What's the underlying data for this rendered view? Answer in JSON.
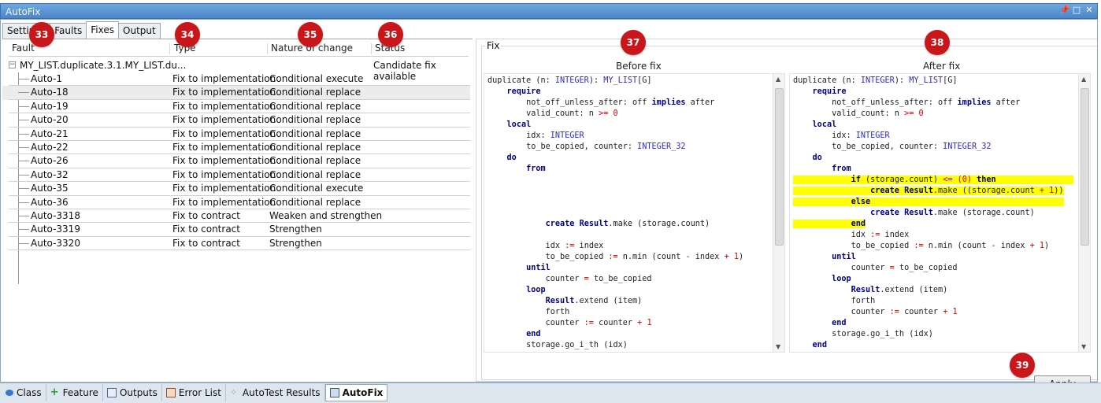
{
  "window": {
    "title": "AutoFix"
  },
  "tabs": [
    {
      "label": "Settings"
    },
    {
      "label": "Faults"
    },
    {
      "label": "Fixes"
    },
    {
      "label": "Output"
    }
  ],
  "table": {
    "headers": {
      "fault": "Fault",
      "type": "Type",
      "nature": "Nature of change",
      "status": "Status"
    },
    "root": {
      "label": "MY_LIST.duplicate.3.1.MY_LIST.du...",
      "status": "Candidate fix available"
    },
    "rows": [
      {
        "fault": "Auto-1",
        "type": "Fix to implementation",
        "nature": "Conditional execute"
      },
      {
        "fault": "Auto-18",
        "type": "Fix to implementation",
        "nature": "Conditional replace"
      },
      {
        "fault": "Auto-19",
        "type": "Fix to implementation",
        "nature": "Conditional replace"
      },
      {
        "fault": "Auto-20",
        "type": "Fix to implementation",
        "nature": "Conditional replace"
      },
      {
        "fault": "Auto-21",
        "type": "Fix to implementation",
        "nature": "Conditional replace"
      },
      {
        "fault": "Auto-22",
        "type": "Fix to implementation",
        "nature": "Conditional replace"
      },
      {
        "fault": "Auto-26",
        "type": "Fix to implementation",
        "nature": "Conditional replace"
      },
      {
        "fault": "Auto-32",
        "type": "Fix to implementation",
        "nature": "Conditional replace"
      },
      {
        "fault": "Auto-35",
        "type": "Fix to implementation",
        "nature": "Conditional execute"
      },
      {
        "fault": "Auto-36",
        "type": "Fix to implementation",
        "nature": "Conditional replace"
      },
      {
        "fault": "Auto-3318",
        "type": "Fix to contract",
        "nature": "Weaken and strengthen"
      },
      {
        "fault": "Auto-3319",
        "type": "Fix to contract",
        "nature": "Strengthen"
      },
      {
        "fault": "Auto-3320",
        "type": "Fix to contract",
        "nature": "Strengthen"
      }
    ]
  },
  "fix": {
    "legend": "Fix",
    "before_label": "Before fix",
    "after_label": "After fix",
    "apply_label": "Apply"
  },
  "badges": {
    "b33": "33",
    "b34": "34",
    "b35": "35",
    "b36": "36",
    "b37": "37",
    "b38": "38",
    "b39": "39"
  },
  "bottom_tabs": [
    {
      "label": "Class"
    },
    {
      "label": "Feature"
    },
    {
      "label": "Outputs"
    },
    {
      "label": "Error List"
    },
    {
      "label": "AutoTest Results"
    },
    {
      "label": "AutoFix"
    }
  ],
  "code": {
    "before": [
      [
        [
          "n",
          "duplicate (n: "
        ],
        [
          "t",
          "INTEGER"
        ],
        [
          "n",
          "): "
        ],
        [
          "t",
          "MY_LIST"
        ],
        [
          "n",
          "[G]"
        ]
      ],
      [
        [
          "n",
          "    "
        ],
        [
          "k",
          "require"
        ]
      ],
      [
        [
          "n",
          "        not_off_unless_after: off "
        ],
        [
          "k",
          "implies"
        ],
        [
          "n",
          " after"
        ]
      ],
      [
        [
          "n",
          "        valid_count: n "
        ],
        [
          "o",
          ">="
        ],
        [
          "n",
          " "
        ],
        [
          "o",
          "0"
        ]
      ],
      [
        [
          "n",
          "    "
        ],
        [
          "k",
          "local"
        ]
      ],
      [
        [
          "n",
          "        idx: "
        ],
        [
          "t",
          "INTEGER"
        ]
      ],
      [
        [
          "n",
          "        to_be_copied, counter: "
        ],
        [
          "t",
          "INTEGER_32"
        ]
      ],
      [
        [
          "n",
          "    "
        ],
        [
          "k",
          "do"
        ]
      ],
      [
        [
          "n",
          "        "
        ],
        [
          "k",
          "from"
        ]
      ],
      [
        [
          "n",
          ""
        ]
      ],
      [
        [
          "n",
          ""
        ]
      ],
      [
        [
          "n",
          ""
        ]
      ],
      [
        [
          "n",
          ""
        ]
      ],
      [
        [
          "n",
          "            "
        ],
        [
          "k",
          "create"
        ],
        [
          "n",
          " "
        ],
        [
          "k",
          "Result"
        ],
        [
          "n",
          ".make (storage.count)"
        ]
      ],
      [
        [
          "n",
          ""
        ]
      ],
      [
        [
          "n",
          "            idx "
        ],
        [
          "o",
          ":="
        ],
        [
          "n",
          " index"
        ]
      ],
      [
        [
          "n",
          "            to_be_copied "
        ],
        [
          "o",
          ":="
        ],
        [
          "n",
          " n.min (count "
        ],
        [
          "o",
          "-"
        ],
        [
          "n",
          " index "
        ],
        [
          "o",
          "+"
        ],
        [
          "n",
          " "
        ],
        [
          "o",
          "1"
        ],
        [
          "n",
          ")"
        ]
      ],
      [
        [
          "n",
          "        "
        ],
        [
          "k",
          "until"
        ]
      ],
      [
        [
          "n",
          "            counter "
        ],
        [
          "o",
          "="
        ],
        [
          "n",
          " to_be_copied"
        ]
      ],
      [
        [
          "n",
          "        "
        ],
        [
          "k",
          "loop"
        ]
      ],
      [
        [
          "n",
          "            "
        ],
        [
          "k",
          "Result"
        ],
        [
          "n",
          ".extend (item)"
        ]
      ],
      [
        [
          "n",
          "            forth"
        ]
      ],
      [
        [
          "n",
          "            counter "
        ],
        [
          "o",
          ":="
        ],
        [
          "n",
          " counter "
        ],
        [
          "o",
          "+"
        ],
        [
          "n",
          " "
        ],
        [
          "o",
          "1"
        ]
      ],
      [
        [
          "n",
          "        "
        ],
        [
          "k",
          "end"
        ]
      ],
      [
        [
          "n",
          "        storage.go_i_th (idx)"
        ]
      ],
      [
        [
          "n",
          "    "
        ],
        [
          "k",
          "end"
        ]
      ]
    ],
    "after": [
      [
        [
          "n",
          "duplicate (n: "
        ],
        [
          "t",
          "INTEGER"
        ],
        [
          "n",
          "): "
        ],
        [
          "t",
          "MY_LIST"
        ],
        [
          "n",
          "[G]"
        ]
      ],
      [
        [
          "n",
          "    "
        ],
        [
          "k",
          "require"
        ]
      ],
      [
        [
          "n",
          "        not_off_unless_after: off "
        ],
        [
          "k",
          "implies"
        ],
        [
          "n",
          " after"
        ]
      ],
      [
        [
          "n",
          "        valid_count: n "
        ],
        [
          "o",
          ">="
        ],
        [
          "n",
          " "
        ],
        [
          "o",
          "0"
        ]
      ],
      [
        [
          "n",
          "    "
        ],
        [
          "k",
          "local"
        ]
      ],
      [
        [
          "n",
          "        idx: "
        ],
        [
          "t",
          "INTEGER"
        ]
      ],
      [
        [
          "n",
          "        to_be_copied, counter: "
        ],
        [
          "t",
          "INTEGER_32"
        ]
      ],
      [
        [
          "n",
          "    "
        ],
        [
          "k",
          "do"
        ]
      ],
      [
        [
          "n",
          "        "
        ],
        [
          "k",
          "from"
        ]
      ],
      [
        [
          "h",
          "            "
        ],
        [
          "hk",
          "if"
        ],
        [
          "h",
          " (storage.count) "
        ],
        [
          "ho",
          "<="
        ],
        [
          "h",
          " "
        ],
        [
          "ho",
          "(0)"
        ],
        [
          "h",
          " "
        ],
        [
          "hk",
          "then"
        ],
        [
          "h",
          "                "
        ]
      ],
      [
        [
          "h",
          "                "
        ],
        [
          "hk",
          "create"
        ],
        [
          "h",
          " "
        ],
        [
          "hk",
          "Result"
        ],
        [
          "h",
          ".make ((storage.count "
        ],
        [
          "ho",
          "+"
        ],
        [
          "h",
          " "
        ],
        [
          "ho",
          "1"
        ],
        [
          "h",
          "))"
        ]
      ],
      [
        [
          "h",
          "            "
        ],
        [
          "hk",
          "else"
        ],
        [
          "h",
          "                                        "
        ]
      ],
      [
        [
          "n",
          "                "
        ],
        [
          "k",
          "create"
        ],
        [
          "n",
          " "
        ],
        [
          "k",
          "Result"
        ],
        [
          "n",
          ".make (storage.count)"
        ]
      ],
      [
        [
          "h",
          "            "
        ],
        [
          "hk",
          "end"
        ]
      ],
      [
        [
          "n",
          "            idx "
        ],
        [
          "o",
          ":="
        ],
        [
          "n",
          " index"
        ]
      ],
      [
        [
          "n",
          "            to_be_copied "
        ],
        [
          "o",
          ":="
        ],
        [
          "n",
          " n.min (count "
        ],
        [
          "o",
          "-"
        ],
        [
          "n",
          " index "
        ],
        [
          "o",
          "+"
        ],
        [
          "n",
          " "
        ],
        [
          "o",
          "1"
        ],
        [
          "n",
          ")"
        ]
      ],
      [
        [
          "n",
          "        "
        ],
        [
          "k",
          "until"
        ]
      ],
      [
        [
          "n",
          "            counter "
        ],
        [
          "o",
          "="
        ],
        [
          "n",
          " to_be_copied"
        ]
      ],
      [
        [
          "n",
          "        "
        ],
        [
          "k",
          "loop"
        ]
      ],
      [
        [
          "n",
          "            "
        ],
        [
          "k",
          "Result"
        ],
        [
          "n",
          ".extend (item)"
        ]
      ],
      [
        [
          "n",
          "            forth"
        ]
      ],
      [
        [
          "n",
          "            counter "
        ],
        [
          "o",
          ":="
        ],
        [
          "n",
          " counter "
        ],
        [
          "o",
          "+"
        ],
        [
          "n",
          " "
        ],
        [
          "o",
          "1"
        ]
      ],
      [
        [
          "n",
          "        "
        ],
        [
          "k",
          "end"
        ]
      ],
      [
        [
          "n",
          "        storage.go_i_th (idx)"
        ]
      ],
      [
        [
          "n",
          "    "
        ],
        [
          "k",
          "end"
        ]
      ]
    ],
    "colors": {
      "keyword": "#00008b",
      "type": "#2a2ad0",
      "operator": "#d40000",
      "highlight": "#ffff00",
      "text": "#222222"
    }
  }
}
